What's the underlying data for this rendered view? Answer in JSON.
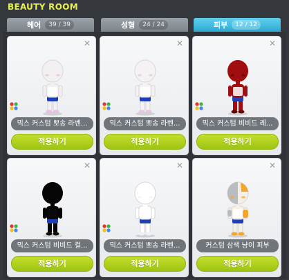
{
  "window": {
    "title": "BEAUTY ROOM"
  },
  "tabs": [
    {
      "label": "헤어",
      "count": "39 / 39",
      "active": false
    },
    {
      "label": "성형",
      "count": "24 / 24",
      "active": false
    },
    {
      "label": "피부",
      "count": "12 / 12",
      "active": true
    }
  ],
  "cards": [
    {
      "name": "믹스 커스텀 뽀송 라벤...",
      "button": "적용하기",
      "skin": "#f3f0f2",
      "skin_shade": "#e7bfe0",
      "mix_icon": true
    },
    {
      "name": "믹스 커스텀 뽀송 라벤...",
      "button": "적용하기",
      "skin": "#f5f2f4",
      "skin_shade": "#e3c6e0",
      "mix_icon": true
    },
    {
      "name": "믹스 커스텀 비비드 레...",
      "button": "적용하기",
      "skin": "#a10e10",
      "skin_shade": "#6c0405",
      "mix_icon": true
    },
    {
      "name": "믹스 커스텀 비비드 컬...",
      "button": "적용하기",
      "skin": "#050505",
      "skin_shade": "#000000",
      "mix_icon": true
    },
    {
      "name": "믹스 커스텀 뽀송 라벤...",
      "button": "적용하기",
      "skin": "#ffffff",
      "skin_shade": "#eef2f6",
      "mix_icon": true
    },
    {
      "name": "커스텀 삼색 냥이 피부",
      "button": "적용하기",
      "skin": "#f4f0e6",
      "skin_shade": "#f4a52c",
      "mix_icon": false
    }
  ],
  "colors": {
    "title": "#e8f24e",
    "tab_active": "#2ea9d2",
    "tab_inactive": "#7e858c",
    "apply_button": "#a8cc17",
    "name_pill": "#6f757b"
  },
  "icons": {
    "close": "close-icon",
    "mix": "mix-color-icon"
  }
}
